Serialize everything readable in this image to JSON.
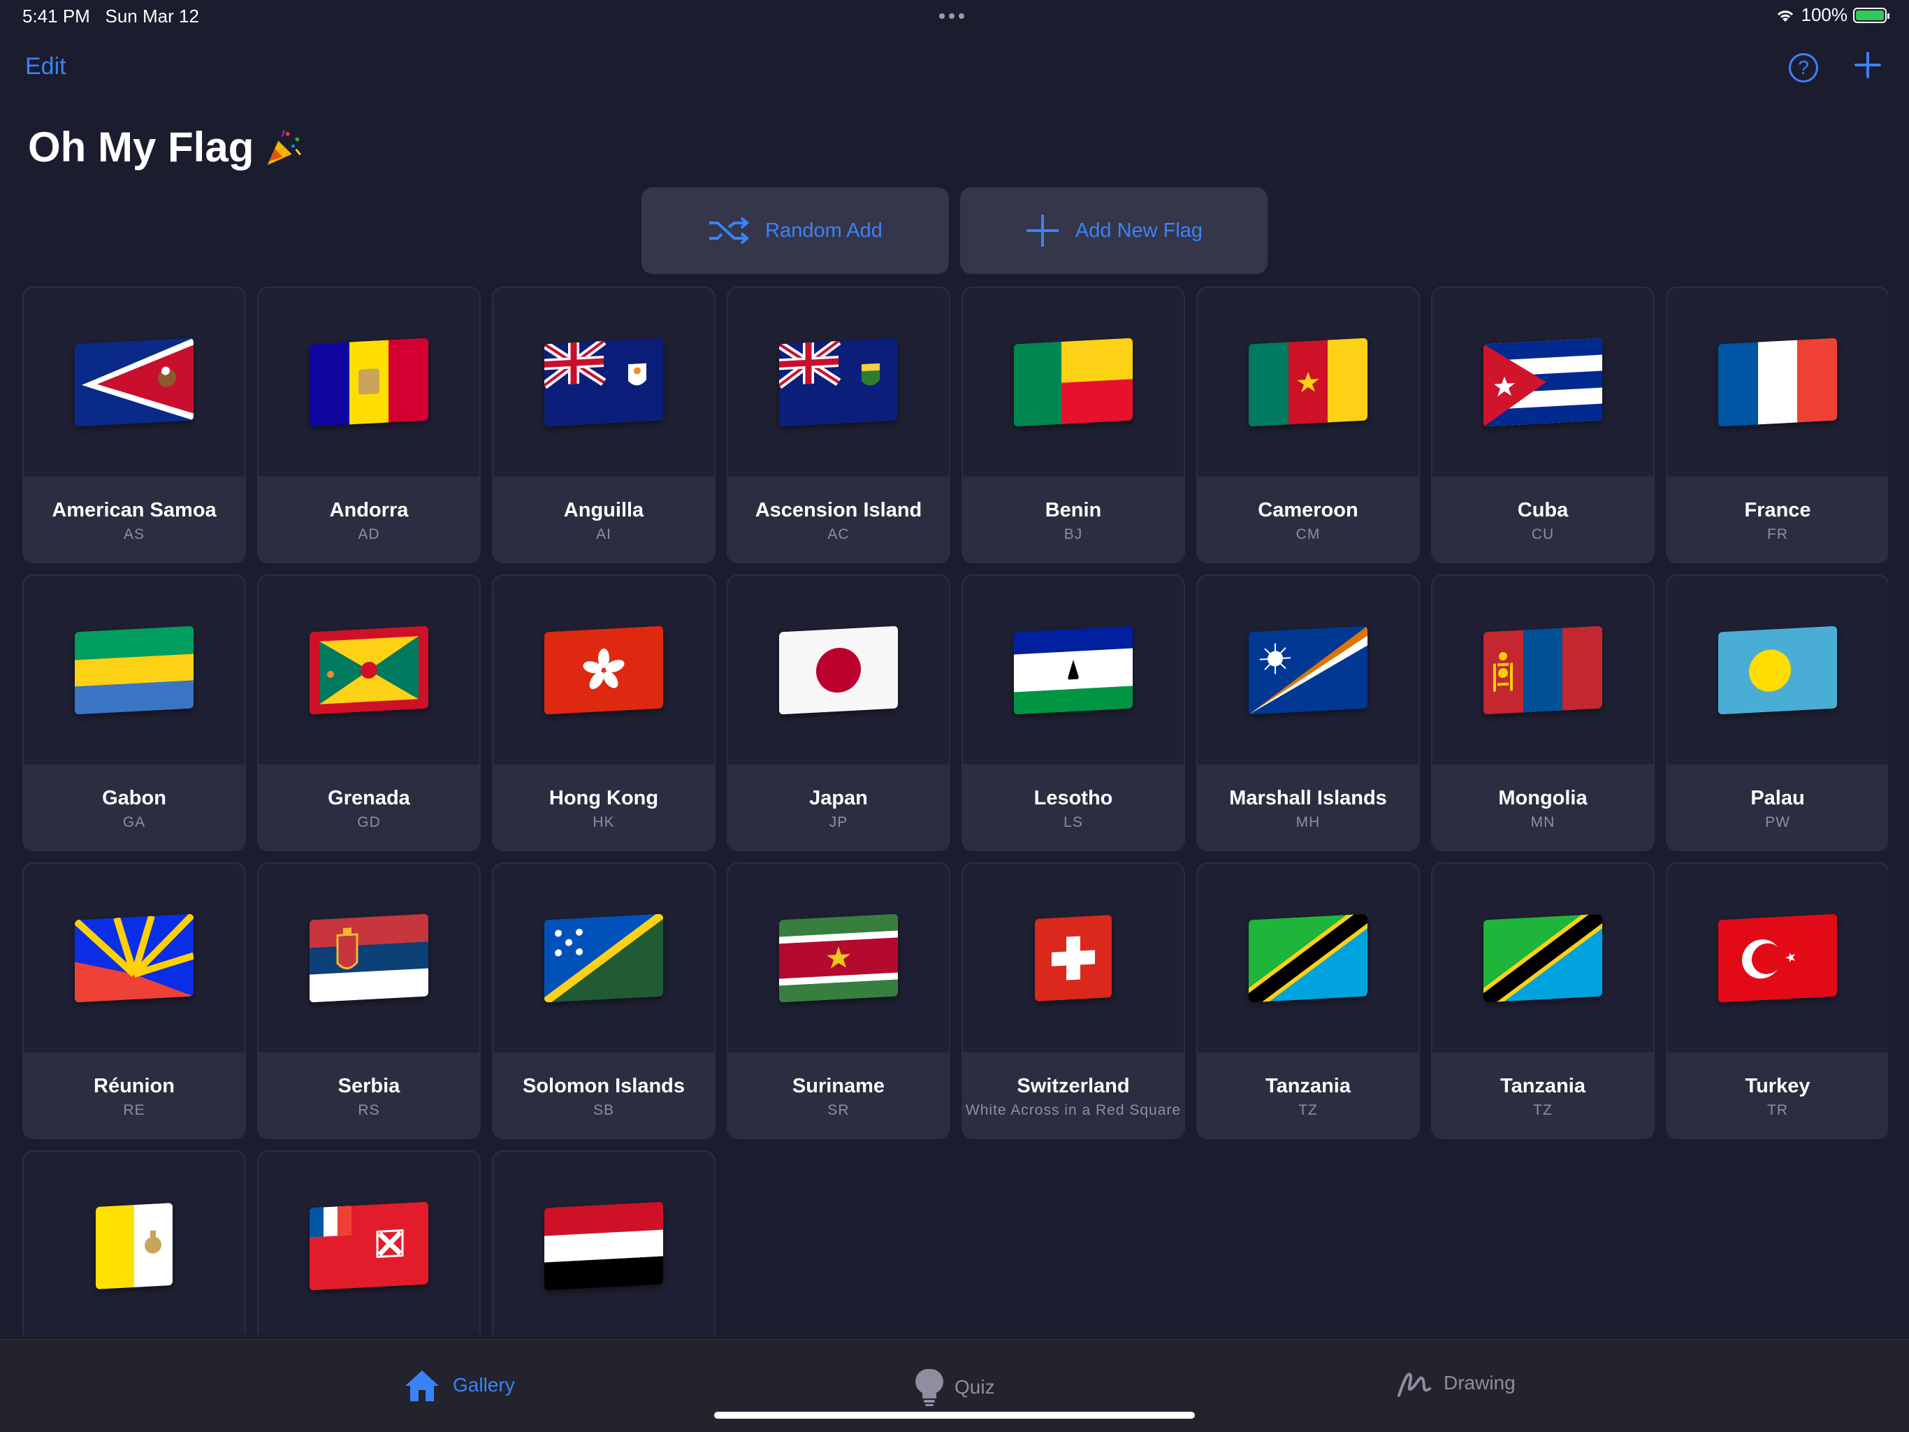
{
  "status": {
    "time": "5:41 PM",
    "date": "Sun Mar 12",
    "battery": "100%"
  },
  "header": {
    "edit_label": "Edit",
    "help_icon": "question-circle-icon",
    "add_icon": "plus-icon"
  },
  "title": {
    "text": "Oh My Flag",
    "icon": "party-popper-icon"
  },
  "actions": {
    "random_label": "Random Add",
    "add_new_label": "Add New Flag"
  },
  "flags": [
    {
      "name": "American Samoa",
      "code": "AS"
    },
    {
      "name": "Andorra",
      "code": "AD"
    },
    {
      "name": "Anguilla",
      "code": "AI"
    },
    {
      "name": "Ascension Island",
      "code": "AC"
    },
    {
      "name": "Benin",
      "code": "BJ"
    },
    {
      "name": "Cameroon",
      "code": "CM"
    },
    {
      "name": "Cuba",
      "code": "CU"
    },
    {
      "name": "France",
      "code": "FR"
    },
    {
      "name": "Gabon",
      "code": "GA"
    },
    {
      "name": "Grenada",
      "code": "GD"
    },
    {
      "name": "Hong Kong",
      "code": "HK"
    },
    {
      "name": "Japan",
      "code": "JP"
    },
    {
      "name": "Lesotho",
      "code": "LS"
    },
    {
      "name": "Marshall Islands",
      "code": "MH"
    },
    {
      "name": "Mongolia",
      "code": "MN"
    },
    {
      "name": "Palau",
      "code": "PW"
    },
    {
      "name": "Réunion",
      "code": "RE"
    },
    {
      "name": "Serbia",
      "code": "RS"
    },
    {
      "name": "Solomon Islands",
      "code": "SB"
    },
    {
      "name": "Suriname",
      "code": "SR"
    },
    {
      "name": "Switzerland",
      "code": "White Across in a Red Square"
    },
    {
      "name": "Tanzania",
      "code": "TZ"
    },
    {
      "name": "Tanzania",
      "code": "TZ"
    },
    {
      "name": "Turkey",
      "code": "TR"
    },
    {
      "name": "",
      "code": ""
    },
    {
      "name": "",
      "code": ""
    },
    {
      "name": "",
      "code": ""
    }
  ],
  "tabs": {
    "gallery": "Gallery",
    "quiz": "Quiz",
    "drawing": "Drawing"
  },
  "colors": {
    "accent": "#3b82f6",
    "background": "#1c1c2f",
    "card": "#1f2033",
    "card_label": "#2c2d40"
  }
}
